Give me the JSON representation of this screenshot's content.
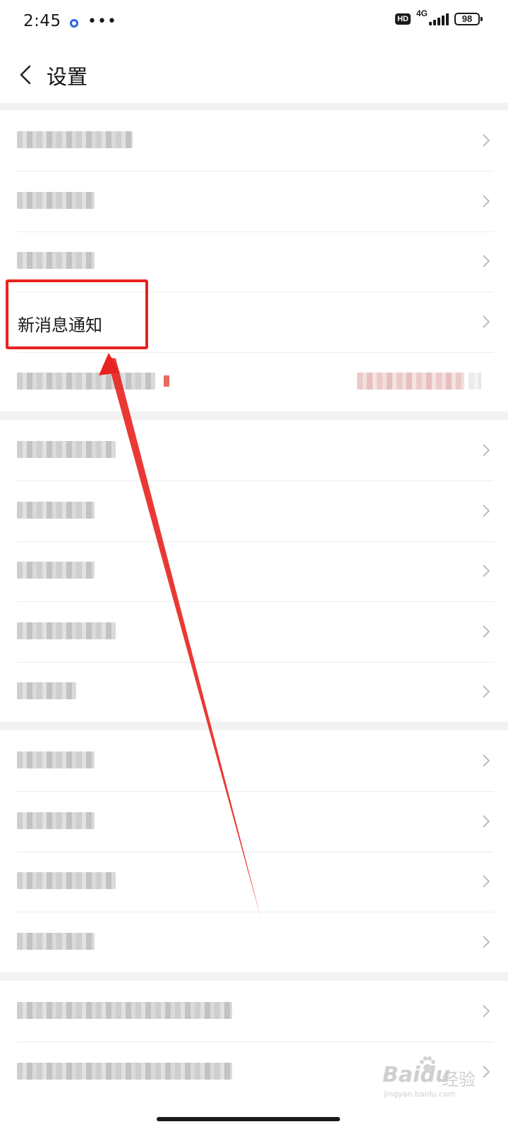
{
  "status_bar": {
    "time": "2:45",
    "more": "•••",
    "hd_badge": "HD",
    "network": "4G",
    "battery": "98"
  },
  "nav": {
    "title": "设置"
  },
  "sections": [
    {
      "rows": [
        {
          "label": "",
          "blurred_width": 164
        },
        {
          "label": "",
          "blurred_width": 110
        },
        {
          "label": "",
          "blurred_width": 110
        },
        {
          "label": "新消息通知",
          "highlighted": true
        },
        {
          "label": "",
          "blurred_width": 220,
          "has_value": true
        }
      ]
    },
    {
      "rows": [
        {
          "label": "",
          "blurred_width": 140
        },
        {
          "label": "",
          "blurred_width": 110
        },
        {
          "label": "",
          "blurred_width": 110
        },
        {
          "label": "",
          "blurred_width": 140
        },
        {
          "label": "",
          "blurred_width": 84
        }
      ]
    },
    {
      "rows": [
        {
          "label": "",
          "blurred_width": 110
        },
        {
          "label": "",
          "blurred_width": 110
        },
        {
          "label": "",
          "blurred_width": 140
        },
        {
          "label": "",
          "blurred_width": 110
        }
      ]
    },
    {
      "rows": [
        {
          "label": "",
          "blurred_width": 305
        },
        {
          "label": "",
          "blurred_width": 305
        }
      ]
    }
  ],
  "watermark": {
    "logo": "Baidu",
    "cn": "经验",
    "sub": "jingyan.baidu.com"
  },
  "colors": {
    "highlight": "#e8231f",
    "arrow": "#e8231f",
    "section_bg": "#f2f2f2",
    "divider": "#ececec"
  }
}
